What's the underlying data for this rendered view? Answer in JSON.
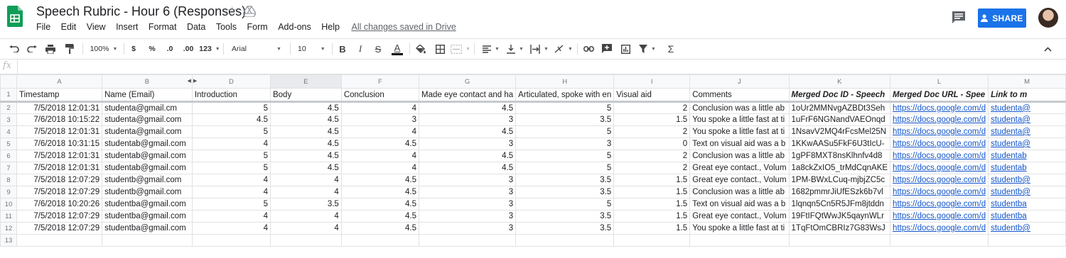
{
  "title": "Speech Rubric - Hour 6 (Responses)",
  "menu": [
    "File",
    "Edit",
    "View",
    "Insert",
    "Format",
    "Data",
    "Tools",
    "Form",
    "Add-ons",
    "Help"
  ],
  "save_status": "All changes saved in Drive",
  "share_label": "SHARE",
  "toolbar": {
    "zoom": "100%",
    "currency": "$",
    "percent": "%",
    "decrease_decimal": ".0",
    "increase_decimal": ".00",
    "more_formats": "123",
    "font": "Arial",
    "font_size": "10",
    "bold": "B",
    "italic": "I",
    "strikethrough": "S",
    "text_color": "A",
    "functions": "Σ"
  },
  "formula_bar": {
    "fx": "fx",
    "value": ""
  },
  "column_letters": [
    "A",
    "B",
    "D",
    "E",
    "F",
    "G",
    "H",
    "I",
    "J",
    "K",
    "L",
    "M"
  ],
  "selected_column": "E",
  "header_row": [
    "Timestamp",
    "Name (Email)",
    "Introduction",
    "Body",
    "Conclusion",
    "Made eye contact and ha",
    "Articulated, spoke with en",
    "Visual aid",
    "Comments",
    "Merged Doc ID - Speech",
    "Merged Doc URL - Spee",
    "Link to m"
  ],
  "rows": [
    [
      "7/5/2018 12:01:31",
      "studenta@gmail.cm",
      "5",
      "4.5",
      "4",
      "4.5",
      "5",
      "2",
      "Conclusion was a little ab",
      "1oUr2MMNvgAZBDt3Seh",
      "https://docs.google.com/d",
      "studenta@"
    ],
    [
      "7/6/2018 10:15:22",
      "studenta@gmail.com",
      "4.5",
      "4.5",
      "3",
      "3",
      "3.5",
      "1.5",
      "You spoke a little fast at ti",
      "1uFrF6NGNandVAEOnqd",
      "https://docs.google.com/d",
      "studenta@"
    ],
    [
      "7/5/2018 12:01:31",
      "studenta@gmail.com",
      "5",
      "4.5",
      "4",
      "4.5",
      "5",
      "2",
      "You spoke a little fast at ti",
      "1NsavV2MQ4rFcsMel25N",
      "https://docs.google.com/d",
      "studenta@"
    ],
    [
      "7/6/2018 10:31:15",
      "studentab@gmail.com",
      "4",
      "4.5",
      "4.5",
      "3",
      "3",
      "0",
      "Text on visual aid was a b",
      "1KKwAASu5FkF6U3tIcU-",
      "https://docs.google.com/d",
      "studenta@"
    ],
    [
      "7/5/2018 12:01:31",
      "studentab@gmail.com",
      "5",
      "4.5",
      "4",
      "4.5",
      "5",
      "2",
      "Conclusion was a little ab",
      "1gPF8MXT8nsKlhnfv4d8",
      "https://docs.google.com/d",
      "studentab"
    ],
    [
      "7/5/2018 12:01:31",
      "studentab@gmail.com",
      "5",
      "4.5",
      "4",
      "4.5",
      "5",
      "2",
      "Great eye contact., Volum",
      "1a8ckZxIO5_trMdCqnAKE",
      "https://docs.google.com/d",
      "studentab"
    ],
    [
      "7/5/2018 12:07:29",
      "studentb@gmail.com",
      "4",
      "4",
      "4.5",
      "3",
      "3.5",
      "1.5",
      "Great eye contact., Volum",
      "1PM-BWxLCuq-mjbjZC5c",
      "https://docs.google.com/d",
      "studentb@"
    ],
    [
      "7/5/2018 12:07:29",
      "studentb@gmail.com",
      "4",
      "4",
      "4.5",
      "3",
      "3.5",
      "1.5",
      "Conclusion was a little ab",
      "1682pmmrJiUfESzk6b7vl",
      "https://docs.google.com/d",
      "studentb@"
    ],
    [
      "7/6/2018 10:20:26",
      "studentba@gmail.com",
      "5",
      "3.5",
      "4.5",
      "3",
      "5",
      "1.5",
      "Text on visual aid was a b",
      "1lqnqn5Cn5R5JFm8jtddn",
      "https://docs.google.com/d",
      "studentba"
    ],
    [
      "7/5/2018 12:07:29",
      "studentba@gmail.com",
      "4",
      "4",
      "4.5",
      "3",
      "3.5",
      "1.5",
      "Great eye contact., Volum",
      "19FtIFQtWwJK5qaynWLr",
      "https://docs.google.com/d",
      "studentba"
    ],
    [
      "7/5/2018 12:07:29",
      "studentba@gmail.com",
      "4",
      "4",
      "4.5",
      "3",
      "3.5",
      "1.5",
      "You spoke a little fast at ti",
      "1TqFtOmCBRIz7G83WsJ",
      "https://docs.google.com/d",
      "studentb@"
    ]
  ],
  "row_numbers": [
    "1",
    "2",
    "3",
    "4",
    "5",
    "6",
    "7",
    "8",
    "9",
    "10",
    "11",
    "12",
    "13"
  ]
}
